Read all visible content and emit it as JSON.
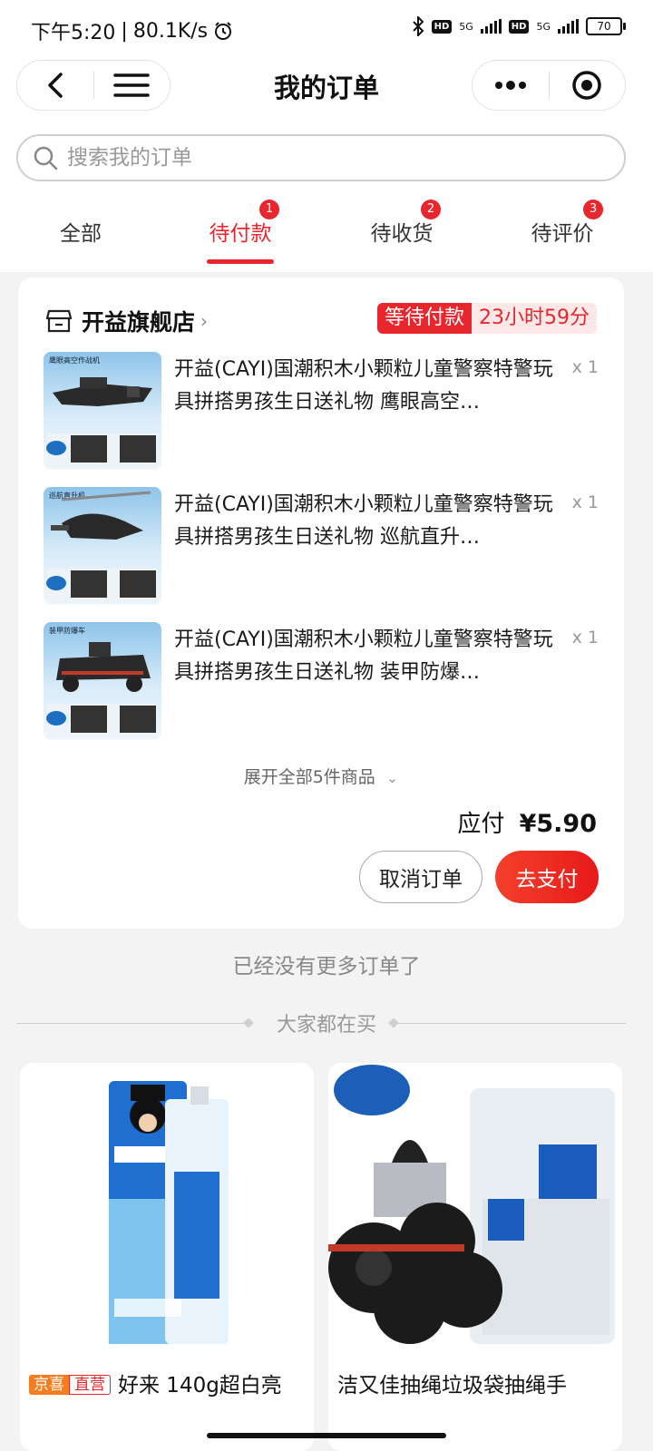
{
  "status_bar": {
    "time": "下午5:20",
    "speed": "80.1K/s",
    "network1": "5G",
    "network2": "5G",
    "battery": "70"
  },
  "nav": {
    "title": "我的订单"
  },
  "search": {
    "placeholder": "搜索我的订单"
  },
  "tabs": [
    {
      "label": "全部",
      "badge": ""
    },
    {
      "label": "待付款",
      "badge": "1"
    },
    {
      "label": "待收货",
      "badge": "2"
    },
    {
      "label": "待评价",
      "badge": "3"
    }
  ],
  "order": {
    "shop_name": "开益旗舰店",
    "status": "等待付款",
    "countdown": "23小时59分",
    "items": [
      {
        "title": "开益(CAYI)国潮积木小颗粒儿童警察特警玩具拼搭男孩生日送礼物 鹰眼高空…",
        "qty": "x 1",
        "thumb_label": "鹰眼高空作战机"
      },
      {
        "title": "开益(CAYI)国潮积木小颗粒儿童警察特警玩具拼搭男孩生日送礼物 巡航直升…",
        "qty": "x 1",
        "thumb_label": "巡航直升机"
      },
      {
        "title": "开益(CAYI)国潮积木小颗粒儿童警察特警玩具拼搭男孩生日送礼物 装甲防爆…",
        "qty": "x 1",
        "thumb_label": "装甲防爆车"
      }
    ],
    "expand_label": "展开全部5件商品",
    "total_label": "应付",
    "total_amount": "¥5.90",
    "cancel_label": "取消订单",
    "pay_label": "去支付"
  },
  "no_more_text": "已经没有更多订单了",
  "recommend": {
    "title": "大家都在买",
    "products": [
      {
        "tag1": "京喜",
        "tag2": "直营",
        "title": "好来 140g超白亮"
      },
      {
        "tag1": "",
        "tag2": "",
        "title": "洁又佳抽绳垃圾袋抽绳手"
      }
    ]
  },
  "colors": {
    "accent": "#e8262d",
    "pay_button": "#f5402c"
  }
}
